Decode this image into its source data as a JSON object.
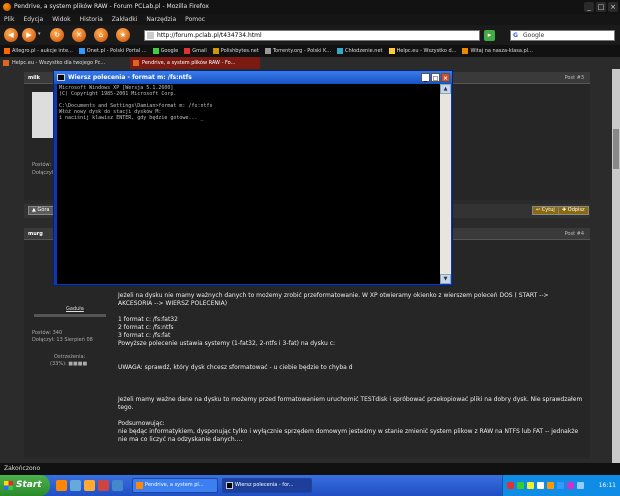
{
  "browser": {
    "title": "Pendrive, a system plików RAW - Forum PCLab.pl - Mozilla Firefox",
    "menu": [
      "Plik",
      "Edycja",
      "Widok",
      "Historia",
      "Zakładki",
      "Narzędzia",
      "Pomoc"
    ],
    "url": "http://forum.pclab.pl/t434734.html",
    "search_placeholder": "Google",
    "bookmarks": [
      "Allegro.pl - aukcje inte...",
      "Onet.pl - Polski Portal ...",
      "Google",
      "Gmail",
      "Polishbytes.net",
      "Torrenty.org - Polski K...",
      "Chłodzenie.net",
      "Helpc.eu - Wszystko d...",
      "Witaj na nasza-klasa.pl..."
    ],
    "tabs": [
      {
        "label": "Helpc.eu - Wszystko dla twojego Pc...",
        "active": false
      },
      {
        "label": "Pendrive, a system plików RAW - Fo...",
        "active": true
      }
    ],
    "status": "Zakończono"
  },
  "forum": {
    "post3": {
      "user": "milk",
      "num": "Post #3",
      "side": [
        "Postów:",
        "Dołączył:"
      ],
      "btn_left": "▲ Góra",
      "btn_reply": "↩ Cytuj",
      "btn_quote": "✚ Odpisz"
    },
    "post4": {
      "user": "murg",
      "num": "Post #4",
      "rank": "Gaduła",
      "posts": "Postów: 340",
      "joined": "Dołączył: 13 Sierpień 08",
      "warn_label": "Ostrzeżenia:",
      "warn_value": "(33%):",
      "lines": [
        "Jeżeli na dysku nie mamy ważnych danych to możemy zrobić przeformatowanie. W XP otwieramy okienko z wierszem poleceń DOS ( START -->",
        "AKCESORIA --> WIERSZ POLECENIA)",
        "",
        "1 format c: /fs:fat32",
        "2 format c: /fs:ntfs",
        "3 format c: /fs:fat",
        "Powyższe polecenie ustawia systemy (1-fat32, 2-ntfs i 3-fat) na dysku c:",
        "",
        "",
        "UWAGA: sprawdź, który dysk chcesz sformatować - u ciebie będzie to chyba d",
        "",
        "",
        "",
        "Jeżeli mamy ważne dane na dysku to możemy przed formatowaniem uruchomić TESTdisk i spróbować przekopiować pliki na dobry dysk. Nie sprawdzałem",
        "tego.",
        "",
        "Podsumowując:",
        "nie będąc informatykiem, dysponując tylko i wyłącznie sprzędem domowym jesteśmy w stanie zmienić system plikow z RAW na NTFS lub FAT -- jednakże",
        "nie ma co liczyć na odzyskanie danych...."
      ]
    }
  },
  "cmd": {
    "title": "Wiersz polecenia - format m: /fs:ntfs",
    "output": "Microsoft Windows XP [Wersja 5.1.2600]\n(C) Copyright 1985-2001 Microsoft Corp.\n\nC:\\Documents and Settings\\Damian>format m: /fs:ntfs\nWłóż nowy dysk do stacji dysków M:\ni naciśnij klawisz ENTER, gdy będzie gotowe... _"
  },
  "taskbar": {
    "start": "Start",
    "tasks": [
      {
        "label": "Pendrive, a system pl...",
        "active": false
      },
      {
        "label": "Wiersz polecenia - for...",
        "active": true
      }
    ],
    "clock": "16:11"
  }
}
